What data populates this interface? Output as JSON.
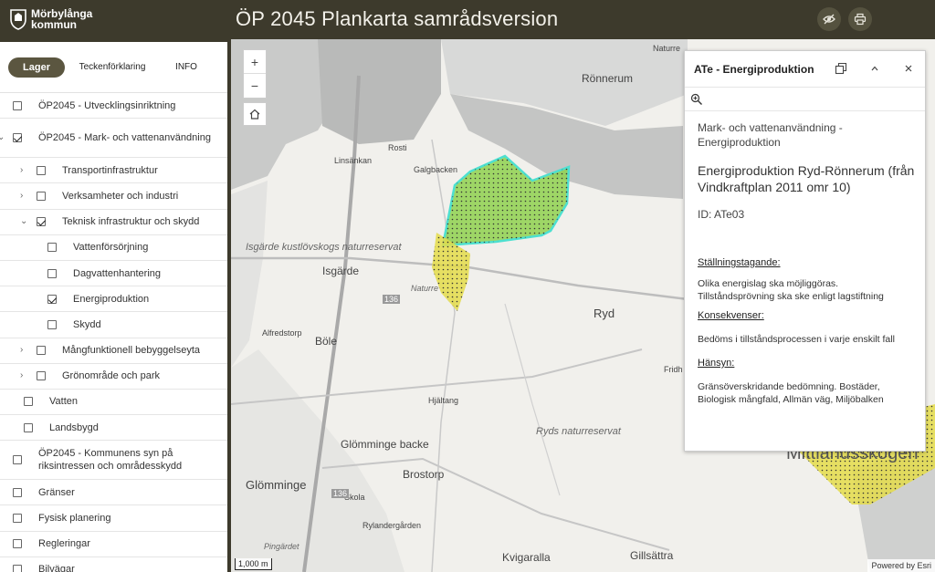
{
  "header": {
    "logo_line1": "Mörbylånga",
    "logo_line2": "kommun",
    "title": "ÖP 2045  Plankarta samrådsversion",
    "buttons": [
      {
        "icon": "eye-slash-icon"
      },
      {
        "icon": "printer-icon"
      }
    ]
  },
  "sidebar": {
    "tabs": [
      "Lager",
      "Teckenförklaring",
      "INFO"
    ],
    "active_tab": "Lager",
    "layers": [
      {
        "label": "ÖP2045 - Utvecklingsinriktning",
        "checked": false,
        "expanded": false,
        "level": 0
      },
      {
        "label": "ÖP2045 - Mark- och vattenanvändning",
        "checked": true,
        "expanded": true,
        "level": 0
      },
      {
        "label": "Transportinfrastruktur",
        "checked": false,
        "expanded": false,
        "level": 1
      },
      {
        "label": "Verksamheter och industri",
        "checked": false,
        "expanded": false,
        "level": 1
      },
      {
        "label": "Teknisk infrastruktur och skydd",
        "checked": true,
        "expanded": true,
        "level": 1
      },
      {
        "label": "Vattenförsörjning",
        "checked": false,
        "level": 2
      },
      {
        "label": "Dagvattenhantering",
        "checked": false,
        "level": 2
      },
      {
        "label": "Energiproduktion",
        "checked": true,
        "level": 2
      },
      {
        "label": "Skydd",
        "checked": false,
        "level": 2
      },
      {
        "label": "Mångfunktionell bebyggelseyta",
        "checked": false,
        "expanded": false,
        "level": 1
      },
      {
        "label": "Grönområde och park",
        "checked": false,
        "expanded": false,
        "level": 1
      },
      {
        "label": "Vatten",
        "checked": false,
        "level": 1
      },
      {
        "label": "Landsbygd",
        "checked": false,
        "level": 1
      },
      {
        "label": "ÖP2045 - Kommunens syn på riksintressen och områdesskydd",
        "checked": false,
        "expanded": false,
        "level": 0
      },
      {
        "label": "Gränser",
        "checked": false,
        "expanded": false,
        "level": 0
      },
      {
        "label": "Fysisk planering",
        "checked": false,
        "expanded": false,
        "level": 0
      },
      {
        "label": "Regleringar",
        "checked": false,
        "expanded": false,
        "level": 0
      },
      {
        "label": "Bilvägar",
        "checked": false,
        "expanded": false,
        "level": 0
      }
    ]
  },
  "map": {
    "zoom_in": "+",
    "zoom_out": "−",
    "scale": "1,000 m",
    "attribution": "Powered by Esri",
    "places": {
      "ronnerum": "Rönnerum",
      "rosti": "Rosti",
      "linsankan": "Linsänkan",
      "galgbacken": "Galgbacken",
      "isgarde_reservat": "Isgärde kustlövskogs naturreservat",
      "isgarde": "Isgärde",
      "naturre": "Naturre",
      "ryd": "Ryd",
      "alfredstorp": "Alfredstorp",
      "bole": "Böle",
      "hjaltang": "Hjältang",
      "ryds_reservat": "Ryds naturreservat",
      "glomminge_backe": "Glömminge backe",
      "brostorp": "Brostorp",
      "glomminge": "Glömminge",
      "skola": "Skola",
      "rylandergarden": "Rylandergården",
      "pingardet": "Pingärdet",
      "kvigaralla": "Kvigaralla",
      "gillsattra": "Gillsättra",
      "fridh": "Fridh",
      "naturre_top": "Naturre",
      "mittlandsskogen": "Mittlandsskogen",
      "road_136": "136",
      "road_136b": "136"
    }
  },
  "popup": {
    "title": "ATe - Energiproduktion",
    "category": "Mark- och vattenanvändning - Energiproduktion",
    "name": "Energiproduktion Ryd-Rönnerum (från Vindkraftplan 2011 omr 10)",
    "id": "ID: ATe03",
    "sections": [
      {
        "heading": "Ställningstagande:",
        "text": "Olika energislag ska möjliggöras. Tillståndsprövning ska ske enligt lagstiftning"
      },
      {
        "heading": "Konsekvenser:",
        "text": "Bedöms i tillståndsprocessen i varje enskilt fall"
      },
      {
        "heading": "Hänsyn:",
        "text": "Gränsöverskridande bedömning. Bostäder, Biologisk mångfald, Allmän väg, Miljöbalken"
      }
    ]
  },
  "colors": {
    "header_bg": "#3d3a2c",
    "tab_active": "#5b5640",
    "zone_green": "#8fd14f",
    "zone_yellow": "#e4dc4a",
    "zone_outline": "#4de0d0"
  }
}
